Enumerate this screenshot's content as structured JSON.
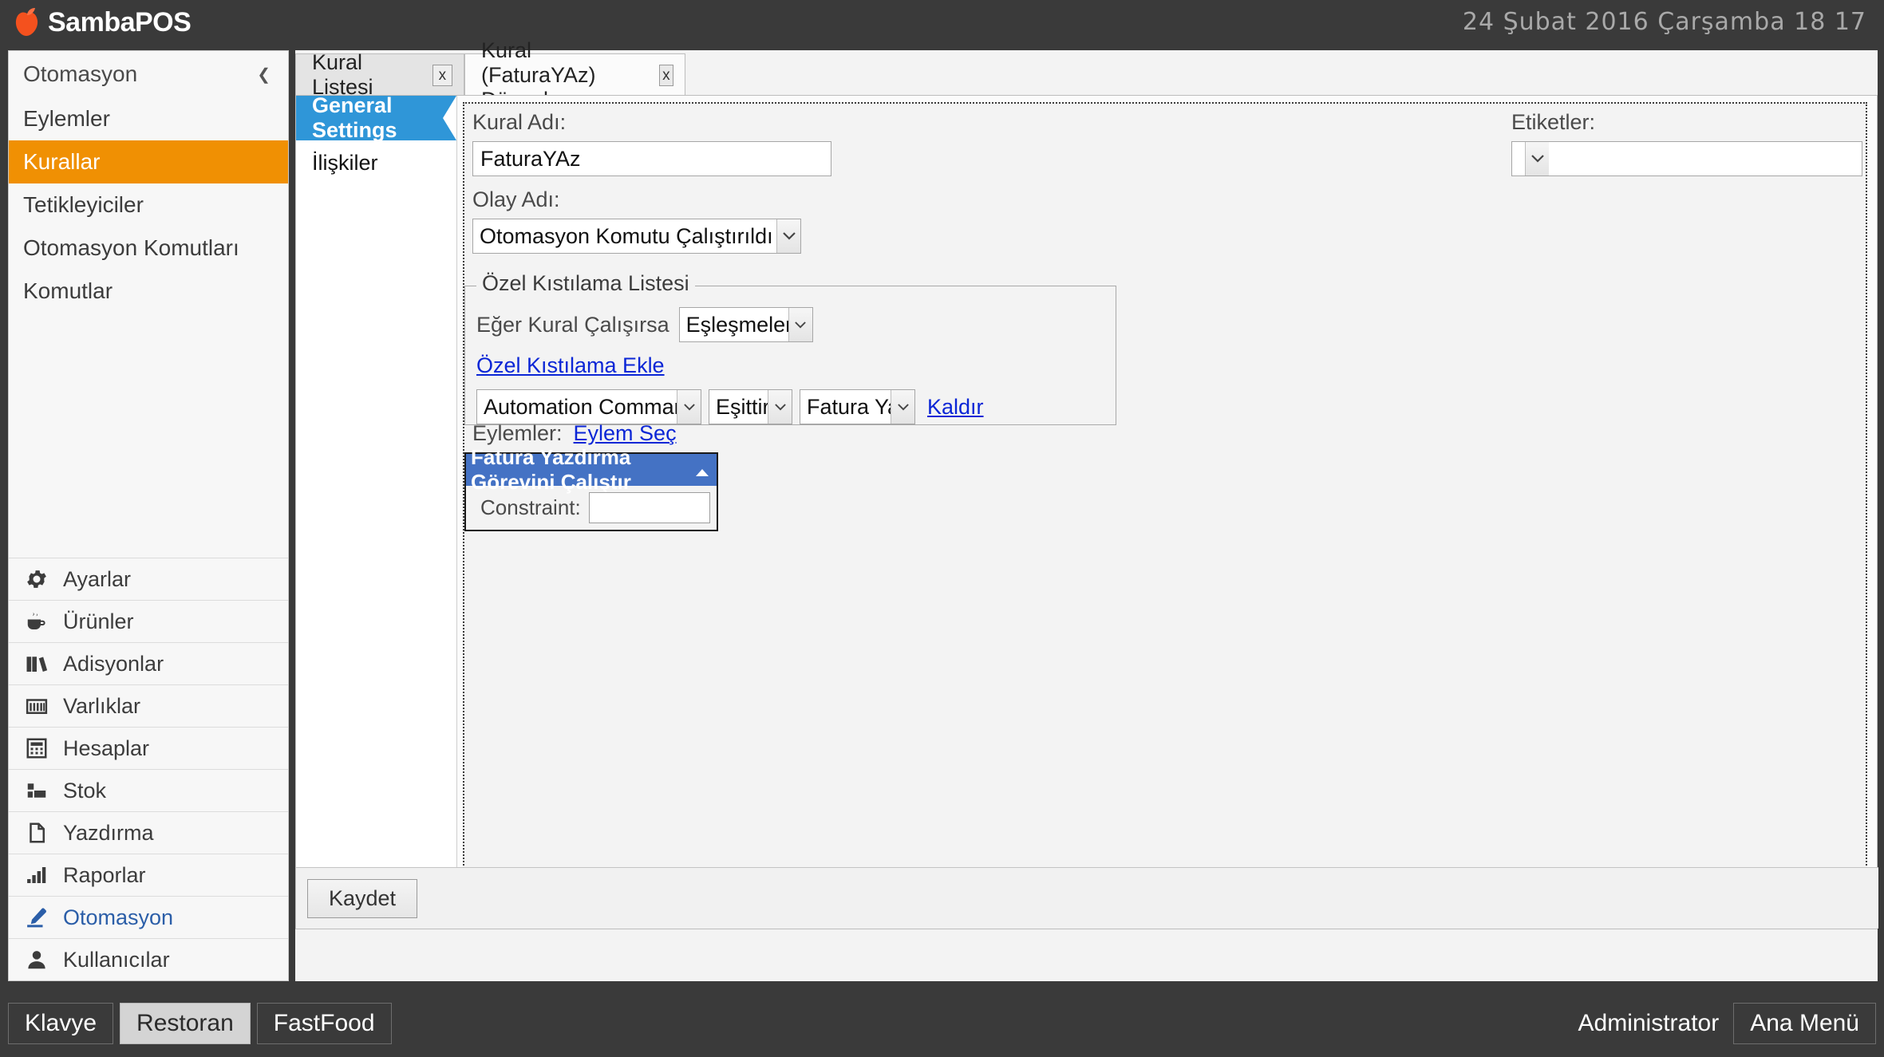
{
  "header": {
    "brand": "SambaPOS",
    "brand_icon": "apple-logo-icon",
    "clock": "24 Şubat 2016 Çarşamba 18 17"
  },
  "sidebar": {
    "title": "Otomasyon",
    "collapse_icon": "chevron-left-icon",
    "nav_items": [
      {
        "label": "Eylemler",
        "active": false
      },
      {
        "label": "Kurallar",
        "active": true
      },
      {
        "label": "Tetikleyiciler",
        "active": false
      },
      {
        "label": "Otomasyon Komutları",
        "active": false
      },
      {
        "label": "Komutlar",
        "active": false
      }
    ],
    "modules": [
      {
        "label": "Ayarlar",
        "icon": "gear-icon",
        "active": false
      },
      {
        "label": "Ürünler",
        "icon": "coffee-cup-icon",
        "active": false
      },
      {
        "label": "Adisyonlar",
        "icon": "books-icon",
        "active": false
      },
      {
        "label": "Varlıklar",
        "icon": "barcode-icon",
        "active": false
      },
      {
        "label": "Hesaplar",
        "icon": "calculator-icon",
        "active": false
      },
      {
        "label": "Stok",
        "icon": "boxes-icon",
        "active": false
      },
      {
        "label": "Yazdırma",
        "icon": "document-icon",
        "active": false
      },
      {
        "label": "Raporlar",
        "icon": "bar-chart-icon",
        "active": false
      },
      {
        "label": "Otomasyon",
        "icon": "marker-pen-icon",
        "active": true
      },
      {
        "label": "Kullanıcılar",
        "icon": "user-icon",
        "active": false
      }
    ]
  },
  "tabs": [
    {
      "label": "Kural Listesi",
      "active": false,
      "close_icon": "x"
    },
    {
      "label": "Kural (FaturaYAz) Düzenle",
      "active": true,
      "close_icon": "x"
    }
  ],
  "subnav": [
    {
      "label": "General Settings",
      "active": true
    },
    {
      "label": "İlişkiler",
      "active": false
    }
  ],
  "form": {
    "rule_name_label": "Kural Adı:",
    "rule_name_value": "FaturaYAz",
    "event_name_label": "Olay Adı:",
    "event_name_value": "Otomasyon Komutu Çalıştırıldı",
    "tags_label": "Etiketler:",
    "tags_value": "",
    "constraint_group": {
      "title": "Özel Kıstılama Listesi",
      "if_rule_label": "Eğer Kural Çalışırsa",
      "match_mode_value": "Eşleşmeler",
      "add_link": "Özel Kıstılama Ekle",
      "rows": [
        {
          "field": "Automation Command Name",
          "operator": "Eşittir",
          "value": "Fatura Yaz",
          "remove_link": "Kaldır"
        }
      ]
    },
    "actions": {
      "label": "Eylemler:",
      "select_link": "Eylem Seç",
      "items": [
        {
          "title": "Fatura Yazdırma Görevini Çalıştır",
          "collapse_icon": "caret-up-icon",
          "constraint_label": "Constraint:",
          "constraint_value": ""
        }
      ]
    },
    "save_label": "Kaydet"
  },
  "taskbar": {
    "buttons": [
      {
        "label": "Klavye",
        "active": false
      },
      {
        "label": "Restoran",
        "active": true
      },
      {
        "label": "FastFood",
        "active": false
      }
    ],
    "user": "Administrator",
    "main_menu": "Ana Menü"
  },
  "colors": {
    "header_bg": "#3a3a3a",
    "accent_orange": "#F09003",
    "accent_blue": "#2F96D8",
    "action_blue": "#4472C4",
    "link_blue": "#0b26d6",
    "active_module_text": "#2B5EA8"
  }
}
